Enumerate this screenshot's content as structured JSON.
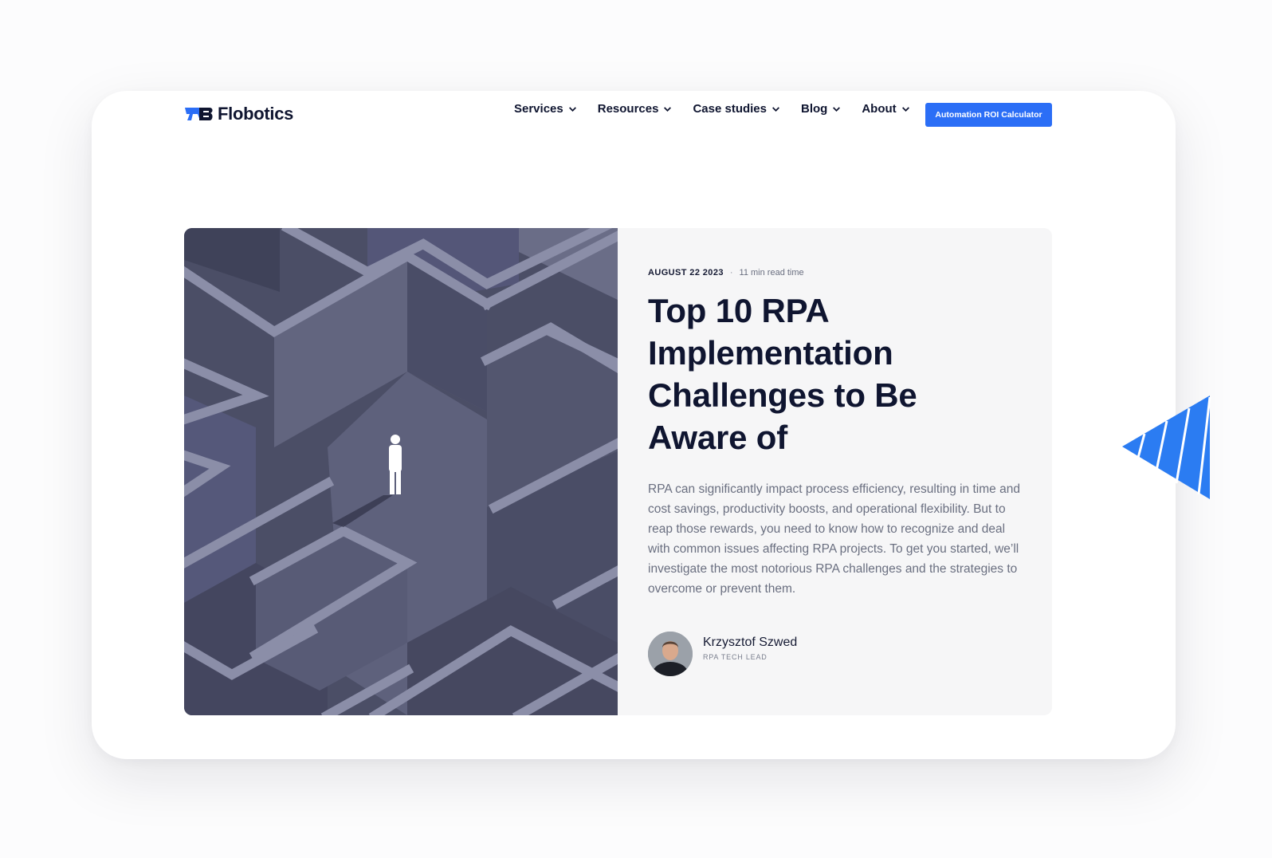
{
  "header": {
    "logo_text": "Flobotics",
    "nav": [
      {
        "label": "Services"
      },
      {
        "label": "Resources"
      },
      {
        "label": "Case studies"
      },
      {
        "label": "Blog"
      },
      {
        "label": "About"
      }
    ],
    "cta_label": "Automation ROI Calculator"
  },
  "article": {
    "date": "AUGUST 22 2023",
    "separator": "·",
    "read_time": "11 min read time",
    "title": "Top 10 RPA Implementation Challenges to Be Aware of",
    "description": "RPA can significantly impact process efficiency, resulting in time and cost savings, productivity boosts, and operational flexibility. But to reap those rewards, you need to know how to recognize and deal with common issues affecting RPA projects. To get you started, we’ll investigate the most notorious RPA challenges and the strategies to overcome or prevent them.",
    "author": {
      "name": "Krzysztof Szwed",
      "role": "RPA TECH LEAD"
    }
  },
  "colors": {
    "brand_blue": "#2b6ef6",
    "text_dark": "#0f1530",
    "muted": "#6a6f80",
    "maze_dark": "#4b4e66",
    "hero_panel": "#f6f6f7"
  },
  "icons": [
    "logo-icon",
    "chevron-down-icon",
    "maze-illustration",
    "avatar-photo",
    "blue-triangle-decoration"
  ]
}
